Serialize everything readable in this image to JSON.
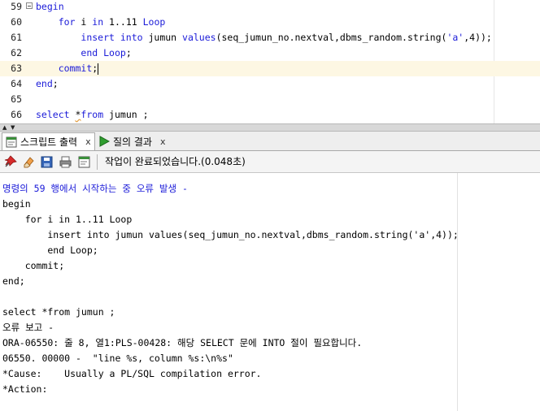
{
  "editor": {
    "lines": [
      {
        "num": "59",
        "segments": [
          {
            "t": "begin",
            "c": "kw"
          }
        ]
      },
      {
        "num": "60",
        "segments": [
          {
            "t": "    "
          },
          {
            "t": "for",
            "c": "kw"
          },
          {
            "t": " i "
          },
          {
            "t": "in",
            "c": "kw"
          },
          {
            "t": " 1..11 "
          },
          {
            "t": "Loop",
            "c": "kw"
          }
        ]
      },
      {
        "num": "61",
        "segments": [
          {
            "t": "        "
          },
          {
            "t": "insert into",
            "c": "kw"
          },
          {
            "t": " jumun "
          },
          {
            "t": "values",
            "c": "kw"
          },
          {
            "t": "(seq_jumun_no.nextval,dbms_random.string("
          },
          {
            "t": "'a'",
            "c": "str"
          },
          {
            "t": ",4));"
          }
        ]
      },
      {
        "num": "62",
        "segments": [
          {
            "t": "        "
          },
          {
            "t": "end",
            "c": "kw"
          },
          {
            "t": " "
          },
          {
            "t": "Loop",
            "c": "kw"
          },
          {
            "t": ";"
          }
        ]
      },
      {
        "num": "63",
        "segments": [
          {
            "t": "    "
          },
          {
            "t": "commit",
            "c": "kw"
          },
          {
            "t": ";"
          }
        ],
        "current": true
      },
      {
        "num": "64",
        "segments": [
          {
            "t": "end",
            "c": "kw"
          },
          {
            "t": ";"
          }
        ]
      },
      {
        "num": "65",
        "segments": []
      },
      {
        "num": "66",
        "segments": [
          {
            "t": "select",
            "c": "kw"
          },
          {
            "t": " "
          },
          {
            "t": "*",
            "c": "squig"
          },
          {
            "t": "from",
            "c": "kw"
          },
          {
            "t": " jumun ;"
          }
        ]
      }
    ]
  },
  "tabs": [
    {
      "label": "스크립트 출력",
      "close": "x",
      "active": true,
      "icon": "script-output-icon"
    },
    {
      "label": "질의 결과",
      "close": "x",
      "active": false,
      "icon": "run-query-icon"
    }
  ],
  "toolbar": {
    "buttons": [
      "pin-icon",
      "eraser-icon",
      "save-icon",
      "print-icon",
      "export-icon"
    ],
    "status": "작업이 완료되었습니다.(0.048초)"
  },
  "output": [
    {
      "text": "명령의 59 행에서 시작하는 중 오류 발생 -",
      "style": "err"
    },
    {
      "text": "begin"
    },
    {
      "text": "    for i in 1..11 Loop"
    },
    {
      "text": "        insert into jumun values(seq_jumun_no.nextval,dbms_random.string('a',4));"
    },
    {
      "text": "        end Loop;"
    },
    {
      "text": "    commit;"
    },
    {
      "text": "end;"
    },
    {
      "text": ""
    },
    {
      "text": "select *from jumun ;"
    },
    {
      "text": "오류 보고 -"
    },
    {
      "text": "ORA-06550: 줄 8, 열1:PLS-00428: 해당 SELECT 문에 INTO 절이 필요합니다."
    },
    {
      "text": "06550. 00000 -  \"line %s, column %s:\\n%s\""
    },
    {
      "text": "*Cause:    Usually a PL/SQL compilation error."
    },
    {
      "text": "*Action:"
    }
  ],
  "colors": {
    "keyword": "#1a1ad8",
    "current_line": "#fdf7e3",
    "error_text": "#1a1ad8"
  }
}
